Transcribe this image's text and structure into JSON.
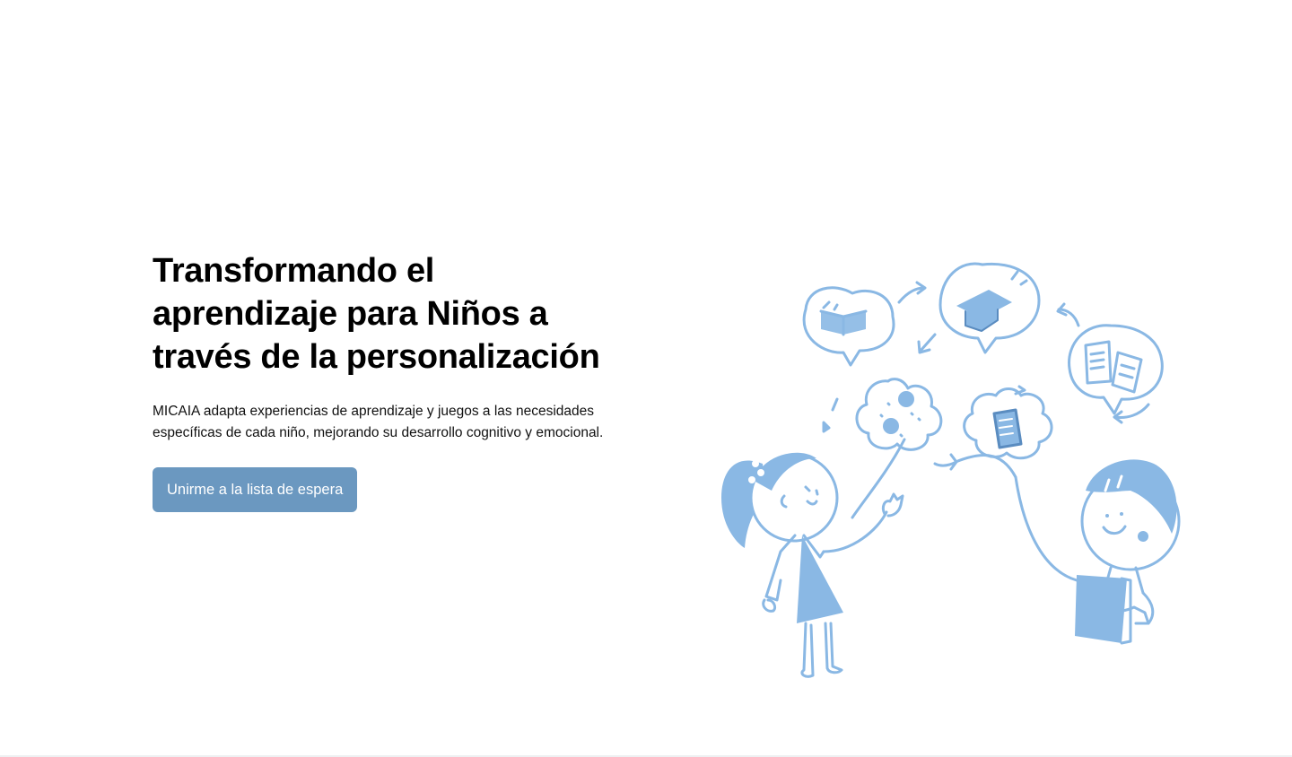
{
  "hero": {
    "title_line1": "Transformando el",
    "title_line2": "aprendizaje para Niños a",
    "title_line3": "través de la personalización",
    "subtitle_line1": "MICAIA adapta experiencias de aprendizaje y juegos a las necesidades",
    "subtitle_line2": "específicas de cada niño, mejorando su desarrollo cognitivo y emocional.",
    "cta_label": "Unirme a la lista de espera"
  },
  "colors": {
    "accent": "#6b98c0",
    "illustration": "#8ab8e4"
  },
  "illustration": {
    "icons": [
      "girl-icon",
      "boy-icon",
      "open-book-icon",
      "graduation-cap-icon",
      "books-icon",
      "document-icon",
      "thought-bubble-icon",
      "arrow-icon"
    ]
  }
}
